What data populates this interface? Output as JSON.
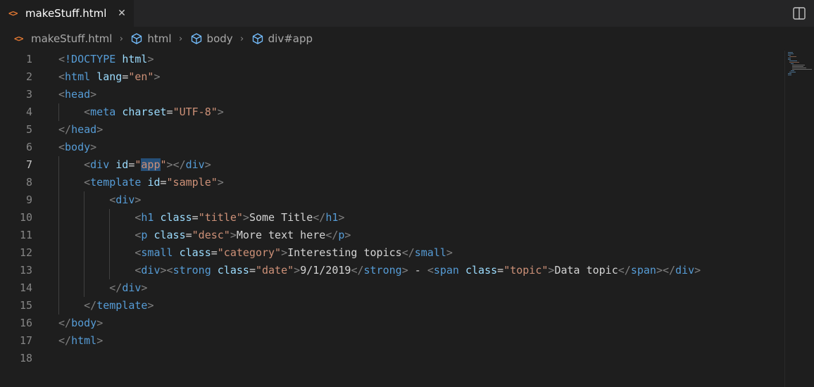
{
  "tab": {
    "icon": "<>",
    "icon_name": "html-file-icon",
    "label": "makeStuff.html",
    "close": "✕"
  },
  "breadcrumb": {
    "file": "makeStuff.html",
    "items": [
      "html",
      "body",
      "div#app"
    ],
    "separator": "›"
  },
  "editor": {
    "active_line": 7,
    "line_numbers": [
      "1",
      "2",
      "3",
      "4",
      "5",
      "6",
      "7",
      "8",
      "9",
      "10",
      "11",
      "12",
      "13",
      "14",
      "15",
      "16",
      "17",
      "18"
    ],
    "lines": [
      [
        [
          "br",
          "<"
        ],
        [
          "tag",
          "!DOCTYPE"
        ],
        [
          "txt",
          " "
        ],
        [
          "attr",
          "html"
        ],
        [
          "br",
          ">"
        ]
      ],
      [
        [
          "br",
          "<"
        ],
        [
          "tag",
          "html"
        ],
        [
          "txt",
          " "
        ],
        [
          "attr",
          "lang"
        ],
        [
          "eq",
          "="
        ],
        [
          "str",
          "\"en\""
        ],
        [
          "br",
          ">"
        ]
      ],
      [
        [
          "br",
          "<"
        ],
        [
          "tag",
          "head"
        ],
        [
          "br",
          ">"
        ]
      ],
      [
        [
          "txt",
          "    "
        ],
        [
          "br",
          "<"
        ],
        [
          "tag",
          "meta"
        ],
        [
          "txt",
          " "
        ],
        [
          "attr",
          "charset"
        ],
        [
          "eq",
          "="
        ],
        [
          "str",
          "\"UTF-8\""
        ],
        [
          "br",
          ">"
        ]
      ],
      [
        [
          "br",
          "</"
        ],
        [
          "tag",
          "head"
        ],
        [
          "br",
          ">"
        ]
      ],
      [
        [
          "br",
          "<"
        ],
        [
          "tag",
          "body"
        ],
        [
          "br",
          ">"
        ]
      ],
      [
        [
          "txt",
          "    "
        ],
        [
          "br",
          "<"
        ],
        [
          "tag",
          "div"
        ],
        [
          "txt",
          " "
        ],
        [
          "attr",
          "id"
        ],
        [
          "eq",
          "="
        ],
        [
          "str",
          "\""
        ],
        [
          "hlstr",
          "app"
        ],
        [
          "str",
          "\""
        ],
        [
          "br",
          "></"
        ],
        [
          "tag",
          "div"
        ],
        [
          "br",
          ">"
        ]
      ],
      [
        [
          "txt",
          "    "
        ],
        [
          "br",
          "<"
        ],
        [
          "tag",
          "template"
        ],
        [
          "txt",
          " "
        ],
        [
          "attr",
          "id"
        ],
        [
          "eq",
          "="
        ],
        [
          "str",
          "\"sample\""
        ],
        [
          "br",
          ">"
        ]
      ],
      [
        [
          "txt",
          "        "
        ],
        [
          "br",
          "<"
        ],
        [
          "tag",
          "div"
        ],
        [
          "br",
          ">"
        ]
      ],
      [
        [
          "txt",
          "            "
        ],
        [
          "br",
          "<"
        ],
        [
          "tag",
          "h1"
        ],
        [
          "txt",
          " "
        ],
        [
          "attr",
          "class"
        ],
        [
          "eq",
          "="
        ],
        [
          "str",
          "\"title\""
        ],
        [
          "br",
          ">"
        ],
        [
          "txt",
          "Some Title"
        ],
        [
          "br",
          "</"
        ],
        [
          "tag",
          "h1"
        ],
        [
          "br",
          ">"
        ]
      ],
      [
        [
          "txt",
          "            "
        ],
        [
          "br",
          "<"
        ],
        [
          "tag",
          "p"
        ],
        [
          "txt",
          " "
        ],
        [
          "attr",
          "class"
        ],
        [
          "eq",
          "="
        ],
        [
          "str",
          "\"desc\""
        ],
        [
          "br",
          ">"
        ],
        [
          "txt",
          "More text here"
        ],
        [
          "br",
          "</"
        ],
        [
          "tag",
          "p"
        ],
        [
          "br",
          ">"
        ]
      ],
      [
        [
          "txt",
          "            "
        ],
        [
          "br",
          "<"
        ],
        [
          "tag",
          "small"
        ],
        [
          "txt",
          " "
        ],
        [
          "attr",
          "class"
        ],
        [
          "eq",
          "="
        ],
        [
          "str",
          "\"category\""
        ],
        [
          "br",
          ">"
        ],
        [
          "txt",
          "Interesting topics"
        ],
        [
          "br",
          "</"
        ],
        [
          "tag",
          "small"
        ],
        [
          "br",
          ">"
        ]
      ],
      [
        [
          "txt",
          "            "
        ],
        [
          "br",
          "<"
        ],
        [
          "tag",
          "div"
        ],
        [
          "br",
          "><"
        ],
        [
          "tag",
          "strong"
        ],
        [
          "txt",
          " "
        ],
        [
          "attr",
          "class"
        ],
        [
          "eq",
          "="
        ],
        [
          "str",
          "\"date\""
        ],
        [
          "br",
          ">"
        ],
        [
          "txt",
          "9/1/2019"
        ],
        [
          "br",
          "</"
        ],
        [
          "tag",
          "strong"
        ],
        [
          "br",
          ">"
        ],
        [
          "txt",
          " - "
        ],
        [
          "br",
          "<"
        ],
        [
          "tag",
          "span"
        ],
        [
          "txt",
          " "
        ],
        [
          "attr",
          "class"
        ],
        [
          "eq",
          "="
        ],
        [
          "str",
          "\"topic\""
        ],
        [
          "br",
          ">"
        ],
        [
          "txt",
          "Data topic"
        ],
        [
          "br",
          "</"
        ],
        [
          "tag",
          "span"
        ],
        [
          "br",
          "></"
        ],
        [
          "tag",
          "div"
        ],
        [
          "br",
          ">"
        ]
      ],
      [
        [
          "txt",
          "        "
        ],
        [
          "br",
          "</"
        ],
        [
          "tag",
          "div"
        ],
        [
          "br",
          ">"
        ]
      ],
      [
        [
          "txt",
          "    "
        ],
        [
          "br",
          "</"
        ],
        [
          "tag",
          "template"
        ],
        [
          "br",
          ">"
        ]
      ],
      [
        [
          "br",
          "</"
        ],
        [
          "tag",
          "body"
        ],
        [
          "br",
          ">"
        ]
      ],
      [
        [
          "br",
          "</"
        ],
        [
          "tag",
          "html"
        ],
        [
          "br",
          ">"
        ]
      ],
      []
    ]
  },
  "colors": {
    "tag": "#569cd6",
    "bracket": "#808080",
    "attribute": "#9cdcfe",
    "string": "#ce9178",
    "text": "#d4d4d4",
    "selection": "#264f78",
    "html_icon": "#e37933"
  },
  "icons": {
    "split_editor": "split-editor-icon",
    "breadcrumb_symbol": "cube-icon"
  }
}
